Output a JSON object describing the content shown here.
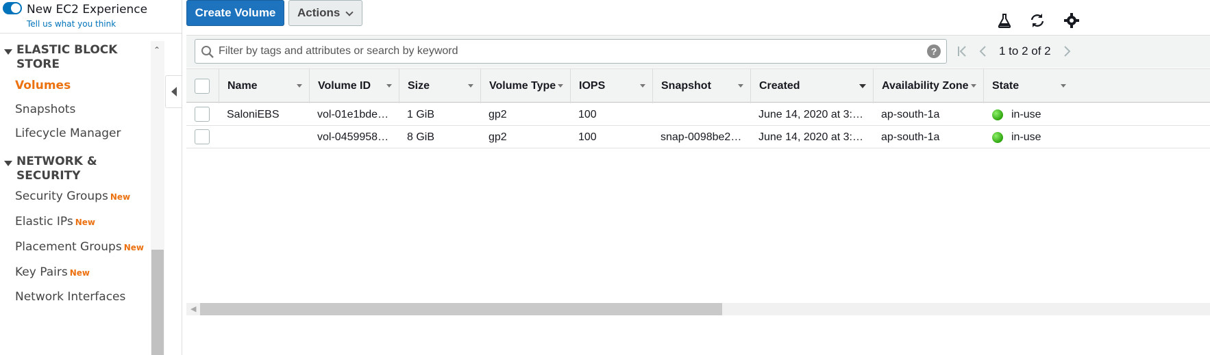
{
  "sidebar": {
    "toggle_label": "New EC2 Experience",
    "feedback_link": "Tell us what you think",
    "sections": [
      {
        "title": "ELASTIC BLOCK STORE"
      },
      {
        "title": "NETWORK & SECURITY"
      }
    ],
    "ebs_items": [
      {
        "label": "Volumes",
        "active": true
      },
      {
        "label": "Snapshots"
      },
      {
        "label": "Lifecycle Manager"
      }
    ],
    "network_items": [
      {
        "label": "Security Groups",
        "badge": "New"
      },
      {
        "label": "Elastic IPs",
        "badge": "New"
      },
      {
        "label": "Placement Groups",
        "badge": "New"
      },
      {
        "label": "Key Pairs",
        "badge": "New"
      },
      {
        "label": "Network Interfaces"
      }
    ]
  },
  "toolbar": {
    "create_label": "Create Volume",
    "actions_label": "Actions",
    "icons": [
      "flask-icon",
      "refresh-icon",
      "gear-icon"
    ]
  },
  "filter": {
    "placeholder": "Filter by tags and attributes or search by keyword",
    "pager_text": "1 to 2 of 2"
  },
  "table": {
    "columns": [
      "Name",
      "Volume ID",
      "Size",
      "Volume Type",
      "IOPS",
      "Snapshot",
      "Created",
      "Availability Zone",
      "State"
    ],
    "rows": [
      {
        "name": "SaloniEBS",
        "volume_id": "vol-01e1bde…",
        "size": "1 GiB",
        "type": "gp2",
        "iops": "100",
        "snapshot": "",
        "created": "June 14, 2020 at 3:…",
        "az": "ap-south-1a",
        "state": "in-use"
      },
      {
        "name": "",
        "volume_id": "vol-0459958…",
        "size": "8 GiB",
        "type": "gp2",
        "iops": "100",
        "snapshot": "snap-0098be2…",
        "created": "June 14, 2020 at 3:…",
        "az": "ap-south-1a",
        "state": "in-use"
      }
    ]
  },
  "colors": {
    "accent": "#1e73be",
    "active_nav": "#ec7211",
    "state_ok": "#2ea50f"
  }
}
